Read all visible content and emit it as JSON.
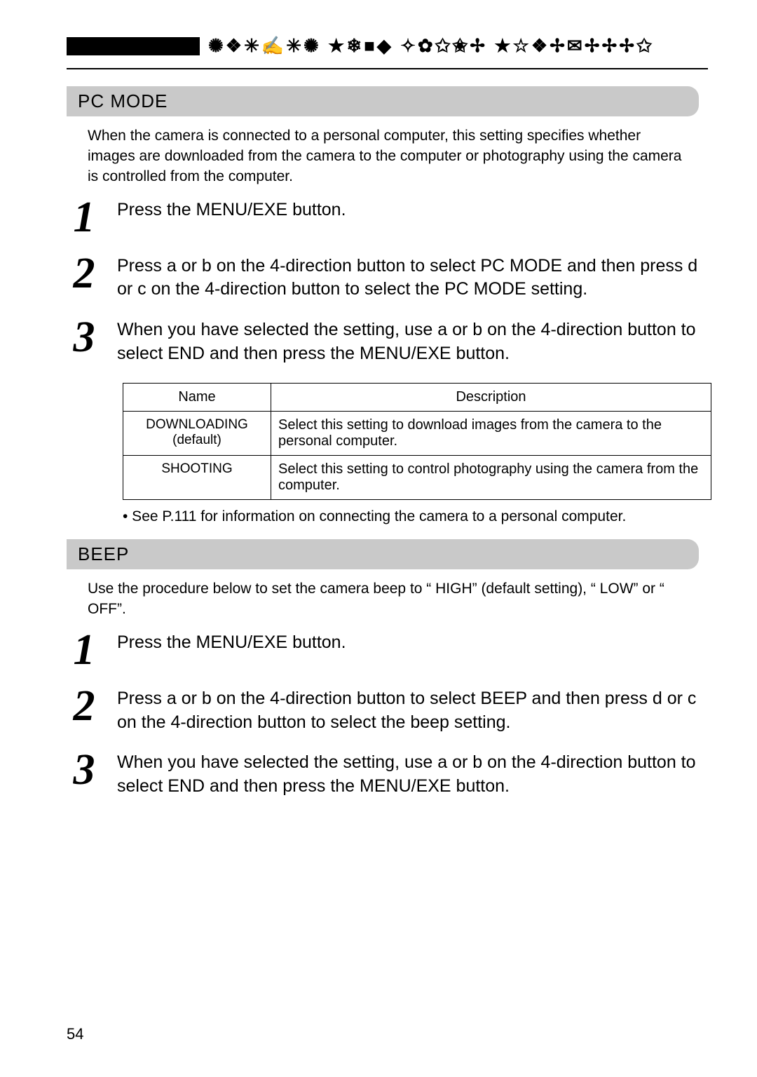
{
  "header": {
    "symbols": "✺❖✳✍✳✺ ★❄■◆ ✧✿✩✬✢ ★☆❖✢✉✢✢✢✩"
  },
  "pcmode": {
    "title": "PC MODE",
    "intro": "When the camera is connected to a personal computer, this setting specifies whether images are downloaded from the camera to the computer or photography using the camera is controlled from the computer.",
    "steps": [
      {
        "n": "1",
        "text": "Press the  MENU/EXE  button."
      },
      {
        "n": "2",
        "text": "Press   a   or   b   on the 4-direction button to select  PC MODE  and then press    d   or   c   on the 4-direction button to select the  PC MODE  setting."
      },
      {
        "n": "3",
        "text": "When you have selected the setting, use    a   or   b   on the 4-direction button to select  END  and then press the  MENU/EXE  button."
      }
    ],
    "table": {
      "headers": [
        "Name",
        "Description"
      ],
      "rows": [
        {
          "name_line1": "DOWNLOADING",
          "name_line2": "(default)",
          "desc": "Select this setting to download images from the camera to the personal computer."
        },
        {
          "name_line1": "SHOOTING",
          "name_line2": "",
          "desc": "Select this setting to control photography using the camera from the computer."
        }
      ]
    },
    "note": "• See P.111 for information on connecting the camera to a personal computer."
  },
  "beep": {
    "title": "BEEP",
    "intro": "Use the procedure below to set the camera beep to “ HIGH” (default setting), “ LOW” or “ OFF”.",
    "steps": [
      {
        "n": "1",
        "text": "Press the  MENU/EXE  button."
      },
      {
        "n": "2",
        "text": "Press   a   or   b   on the 4-direction button to select  BEEP  and then press    d   or   c   on the 4-direction button to select the beep setting."
      },
      {
        "n": "3",
        "text": "When you have selected the setting, use    a   or   b   on the 4-direction button to select  END  and then press the  MENU/EXE  button."
      }
    ]
  },
  "page_number": "54"
}
